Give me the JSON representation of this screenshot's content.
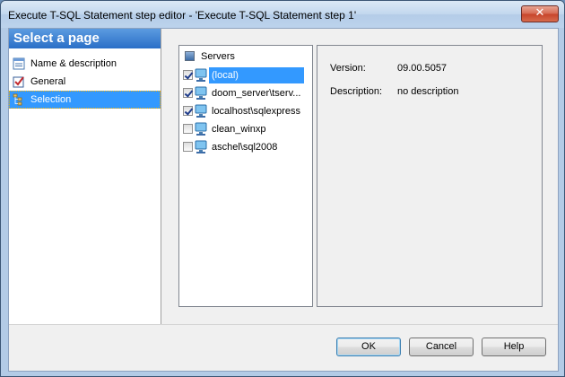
{
  "window": {
    "title": "Execute T-SQL Statement step editor - 'Execute T-SQL Statement step 1'",
    "close_glyph": "✕"
  },
  "sidebar": {
    "header": "Select a page",
    "items": [
      {
        "label": "Name & description",
        "icon": "name-description-icon",
        "active": false
      },
      {
        "label": "General",
        "icon": "general-icon",
        "active": false
      },
      {
        "label": "Selection",
        "icon": "selection-icon",
        "active": true
      }
    ]
  },
  "servers": {
    "header": "Servers",
    "rows": [
      {
        "name": "(local)",
        "checked": true,
        "selected": true
      },
      {
        "name": "doom_server\\tserv...",
        "checked": true,
        "selected": false
      },
      {
        "name": "localhost\\sqlexpress",
        "checked": true,
        "selected": false
      },
      {
        "name": "clean_winxp",
        "checked": false,
        "selected": false
      },
      {
        "name": "aschel\\sql2008",
        "checked": false,
        "selected": false
      }
    ]
  },
  "info": {
    "version_label": "Version:",
    "version_value": "09.00.5057",
    "description_label": "Description:",
    "description_value": "no description"
  },
  "buttons": {
    "ok": "OK",
    "cancel": "Cancel",
    "help": "Help"
  },
  "colors": {
    "selection": "#3399ff",
    "sidebar_header": "#2b6fc7"
  }
}
